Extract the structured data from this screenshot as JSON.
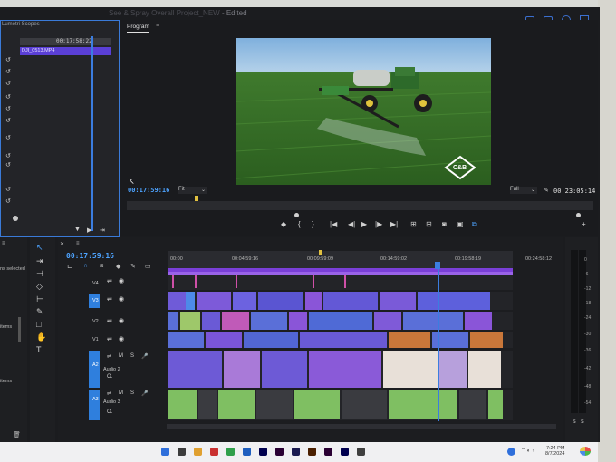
{
  "window": {
    "title": "See & Spray Overall Project_NEW",
    "edited": " - Edited"
  },
  "source_panel": {
    "label": "Lumetri Scopes",
    "timecode": "00:17:58:22",
    "clip_name": "DJI_0513.MP4"
  },
  "program": {
    "tab": "Program",
    "menu_icon": "menu-icon",
    "current_timecode": "00:17:59:16",
    "zoom": "Fit",
    "resolution": "Full",
    "duration": "00:23:05:14",
    "watermark": "C&B"
  },
  "project_panel": {
    "selected_text": "ns selected",
    "items_1": "items",
    "items_2": "items"
  },
  "timeline": {
    "timecode": "00:17:59:16",
    "ruler": [
      "00:00",
      "00:04:59:16",
      "00:09:59:09",
      "00:14:59:02",
      "00:19:58:19",
      "00:24:58:12"
    ],
    "tracks": [
      {
        "id": "V4"
      },
      {
        "id": "V3"
      },
      {
        "id": "V2"
      },
      {
        "id": "V1"
      },
      {
        "id": "A2",
        "name": "Audio 2"
      },
      {
        "id": "A3",
        "name": "Audio 3"
      }
    ]
  },
  "meter": {
    "db": [
      "0",
      "-6",
      "-12",
      "-18",
      "-24",
      "-30",
      "-36",
      "-42",
      "-48",
      "-54"
    ],
    "solo": "S"
  },
  "taskbar": {
    "time": "7:24 PM",
    "date": "8/7/2024"
  },
  "colors": {
    "accent": "#3b7de0",
    "work_area": "#7a3fd8",
    "clip_blue": "#5a6fd8",
    "clip_purple": "#8a55d8",
    "clip_green": "#7fbf62",
    "clip_orange": "#c9773a"
  }
}
